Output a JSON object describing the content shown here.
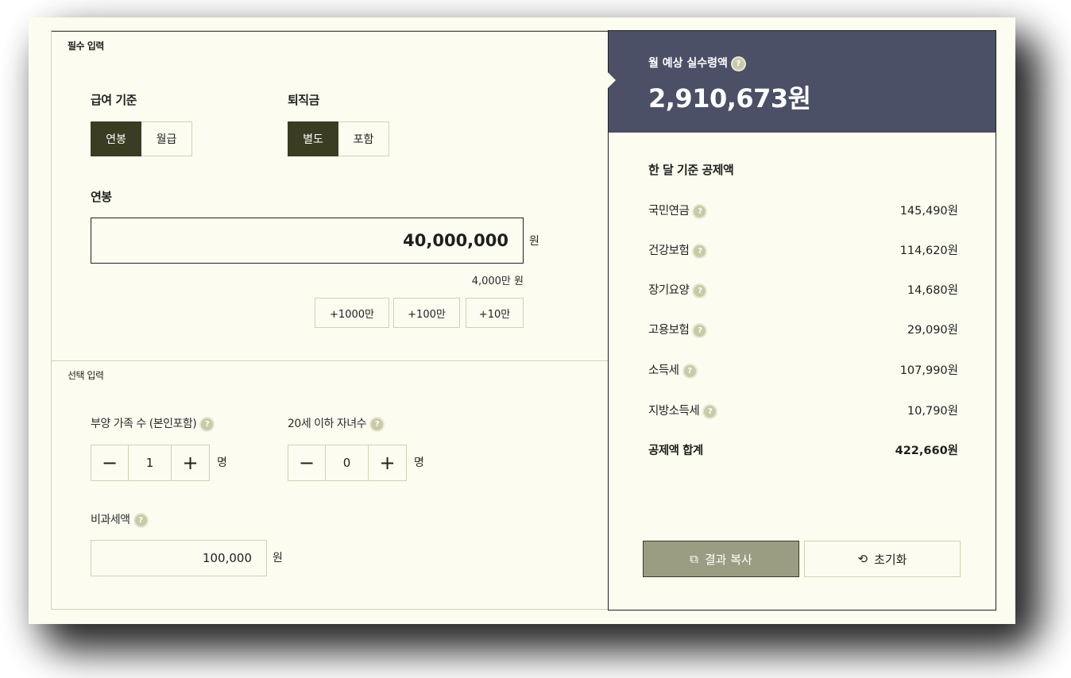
{
  "required": {
    "section_title": "필수 입력",
    "salary_basis": {
      "label": "급여 기준",
      "options": [
        "연봉",
        "월급"
      ],
      "selected": "연봉"
    },
    "severance": {
      "label": "퇴직금",
      "options": [
        "별도",
        "포함"
      ],
      "selected": "별도"
    },
    "salary": {
      "label": "연봉",
      "value": "40,000,000",
      "unit": "원",
      "hint": "4,000만 원"
    },
    "add_buttons": [
      "+1000만",
      "+100만",
      "+10만"
    ]
  },
  "optional": {
    "section_title": "선택 입력",
    "dependents": {
      "label": "부양 가족 수 (본인포함)",
      "value": "1",
      "unit": "명",
      "minus": "−",
      "plus": "+"
    },
    "children": {
      "label": "20세 이하 자녀수",
      "value": "0",
      "unit": "명",
      "minus": "−",
      "plus": "+"
    },
    "nontaxable": {
      "label": "비과세액",
      "value": "100,000",
      "unit": "원"
    }
  },
  "result": {
    "label": "월 예상 실수령액",
    "amount": "2,910,673원",
    "deductions_title": "한 달 기준 공제액",
    "deductions": [
      {
        "name": "국민연금",
        "amount": "145,490원"
      },
      {
        "name": "건강보험",
        "amount": "114,620원"
      },
      {
        "name": "장기요양",
        "amount": "14,680원"
      },
      {
        "name": "고용보험",
        "amount": "29,090원"
      },
      {
        "name": "소득세",
        "amount": "107,990원"
      },
      {
        "name": "지방소득세",
        "amount": "10,790원"
      }
    ],
    "total": {
      "name": "공제액 합계",
      "amount": "422,660원"
    },
    "copy_button": "결과 복사",
    "reset_button": "초기화"
  },
  "icons": {
    "help": "question-circle-icon",
    "copy": "copy-icon",
    "reset": "refresh-icon"
  },
  "colors": {
    "accent_dark": "#3b3d22",
    "header_bg": "#4b5067",
    "panel_bg": "#fcfdf0",
    "copy_bg": "#9a9d82"
  }
}
